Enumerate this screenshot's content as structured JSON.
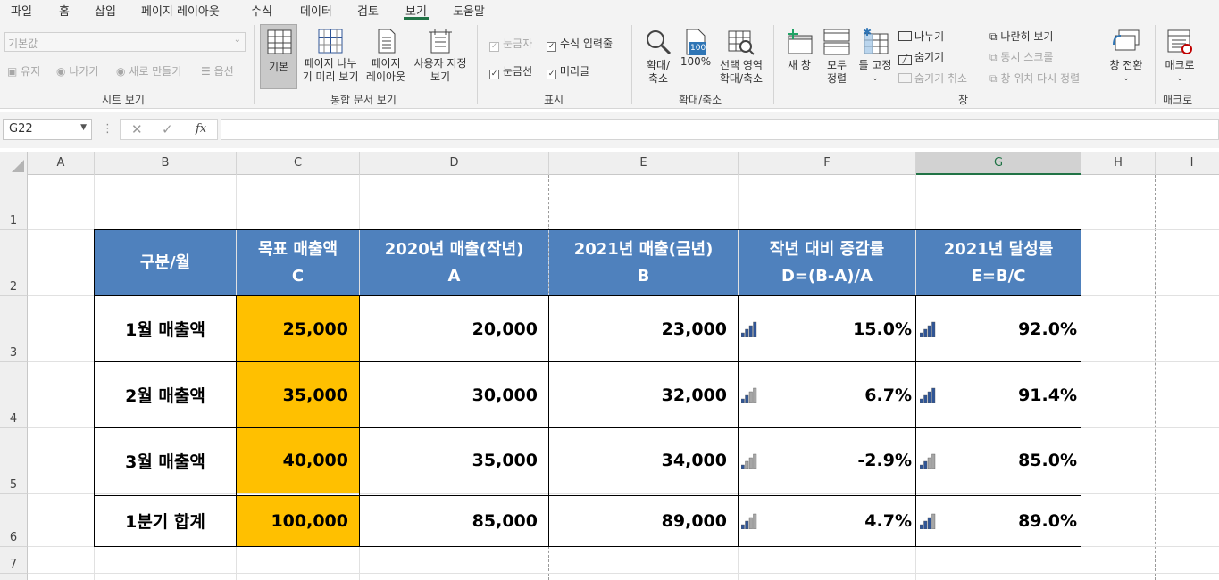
{
  "menu": {
    "items": [
      "파일",
      "홈",
      "삽입",
      "페이지 레이아웃",
      "수식",
      "데이터",
      "검토",
      "보기",
      "도움말"
    ],
    "active": "보기"
  },
  "ribbon": {
    "sheet_view": {
      "dropdown_value": "기본값",
      "keep": "유지",
      "exit": "나가기",
      "new": "새로 만들기",
      "options": "옵션",
      "label": "시트 보기"
    },
    "workbook_views": {
      "normal": "기본",
      "page_break_1": "페이지 나누",
      "page_break_2": "기 미리 보기",
      "page_layout_1": "페이지",
      "page_layout_2": "레이아웃",
      "custom_1": "사용자 지정",
      "custom_2": "보기",
      "label": "통합 문서 보기"
    },
    "show": {
      "ruler": "눈금자",
      "formula_bar": "수식 입력줄",
      "gridlines": "눈금선",
      "headings": "머리글",
      "label": "표시"
    },
    "zoom": {
      "zoom_1": "확대/",
      "zoom_2": "축소",
      "hundred": "100%",
      "hundred_icon_text": "100",
      "zoom_sel_1": "선택 영역",
      "zoom_sel_2": "확대/축소",
      "label": "확대/축소"
    },
    "window": {
      "new_window": "새 창",
      "arrange_1": "모두",
      "arrange_2": "정렬",
      "freeze": "틀 고정",
      "split": "나누기",
      "hide": "숨기기",
      "unhide": "숨기기 취소",
      "side_by_side": "나란히 보기",
      "sync_scroll": "동시 스크롤",
      "reset_pos": "창 위치 다시 정렬",
      "switch": "창 전환",
      "label": "창"
    },
    "macros": {
      "macro": "매크로",
      "label": "매크로"
    }
  },
  "formula_bar": {
    "name_box": "G22",
    "formula": ""
  },
  "columns": [
    "A",
    "B",
    "C",
    "D",
    "E",
    "F",
    "G",
    "H",
    "I"
  ],
  "selected_column": "G",
  "rows": [
    "1",
    "2",
    "3",
    "4",
    "5",
    "6",
    "7"
  ],
  "table": {
    "headers": [
      {
        "l1": "구분/월",
        "l2": ""
      },
      {
        "l1": "목표 매출액",
        "l2": "C"
      },
      {
        "l1": "2020년 매출(작년)",
        "l2": "A"
      },
      {
        "l1": "2021년 매출(금년)",
        "l2": "B"
      },
      {
        "l1": "작년 대비 증감률",
        "l2": "D=(B-A)/A"
      },
      {
        "l1": "2021년 달성률",
        "l2": "E=B/C"
      }
    ],
    "rows": [
      {
        "label": "1월 매출액",
        "target": "25,000",
        "y2020": "20,000",
        "y2021": "23,000",
        "growth": "15.0%",
        "achieve": "92.0%",
        "growth_bars": 4,
        "achieve_bars": 4
      },
      {
        "label": "2월 매출액",
        "target": "35,000",
        "y2020": "30,000",
        "y2021": "32,000",
        "growth": "6.7%",
        "achieve": "91.4%",
        "growth_bars": 2,
        "achieve_bars": 4
      },
      {
        "label": "3월 매출액",
        "target": "40,000",
        "y2020": "35,000",
        "y2021": "34,000",
        "growth": "-2.9%",
        "achieve": "85.0%",
        "growth_bars": 1,
        "achieve_bars": 2
      },
      {
        "label": "1분기 합계",
        "target": "100,000",
        "y2020": "85,000",
        "y2021": "89,000",
        "growth": "4.7%",
        "achieve": "89.0%",
        "growth_bars": 2,
        "achieve_bars": 3
      }
    ]
  },
  "colors": {
    "header_fill": "#4f81bd",
    "target_fill": "#ffc000",
    "bar_on": "#2f5597",
    "bar_off": "#a6a6a6",
    "accent": "#217346"
  }
}
